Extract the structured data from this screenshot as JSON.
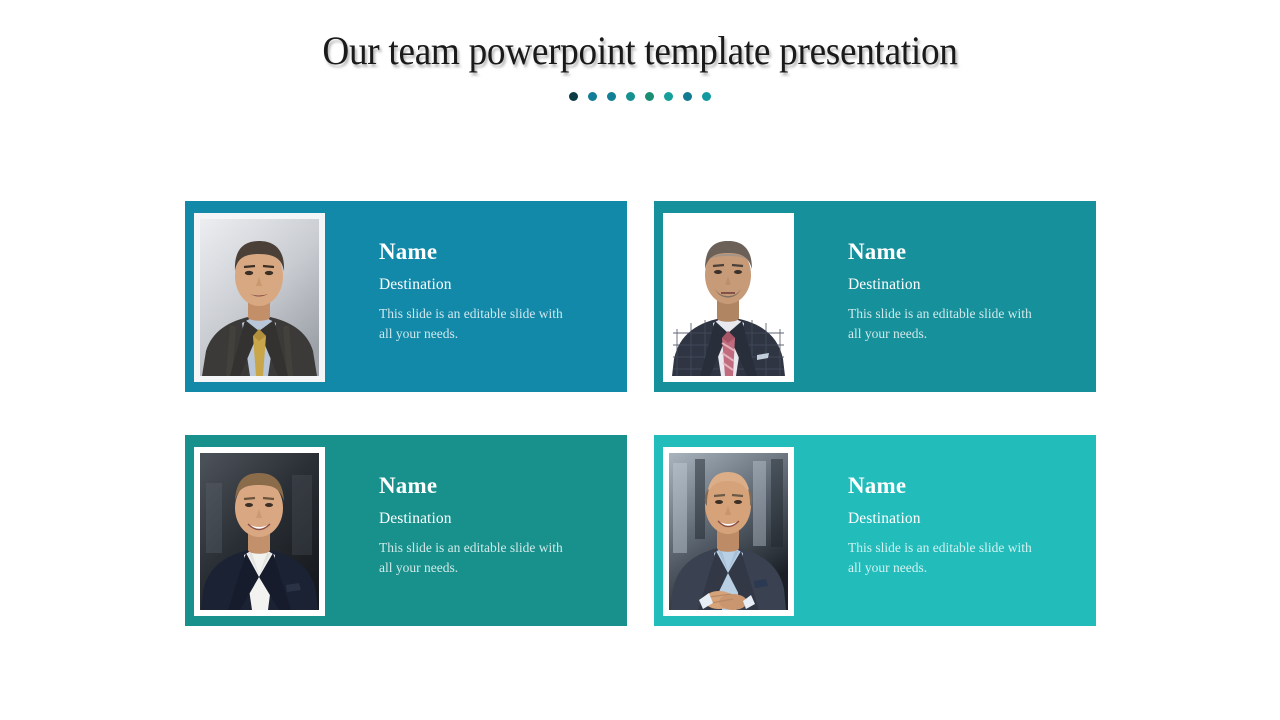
{
  "slide": {
    "background_color": "#ffffff",
    "title": "Our team powerpoint template presentation",
    "title_color": "#1a1a1a"
  },
  "divider_dots": [
    {
      "color": "#0b3c46"
    },
    {
      "color": "#127d96"
    },
    {
      "color": "#117f95"
    },
    {
      "color": "#169190"
    },
    {
      "color": "#198e72"
    },
    {
      "color": "#17a09b"
    },
    {
      "color": "#127b93"
    },
    {
      "color": "#139aa0"
    }
  ],
  "cards": [
    {
      "name": "Name",
      "role": "Destination",
      "description": "This slide is an editable slide with all your needs.",
      "bg_color": "#1289a8",
      "frame_color": "#f4f5f6",
      "photo": {
        "alt": "Portrait of a man in a dark pinstripe suit with a gold patterned tie on a grey studio backdrop",
        "backdrop_from": "#e7e9ec",
        "backdrop_to": "#9ea3aa",
        "suit_color": "#3b3a38",
        "shirt_color": "#b9c6d8",
        "tie_color": "#c9a64a",
        "skin_color": "#d8a882",
        "hair_color": "#4a4038"
      }
    },
    {
      "name": "Name",
      "role": "Destination",
      "description": "This slide is an editable slide with all your needs.",
      "bg_color": "#16909a",
      "frame_color": "#ffffff",
      "photo": {
        "alt": "Portrait of a man in a navy plaid suit with a pink striped tie on a white background",
        "backdrop_from": "#ffffff",
        "backdrop_to": "#f7f7f7",
        "suit_color": "#2f3542",
        "shirt_color": "#e8e8ee",
        "tie_color": "#c06b7e",
        "skin_color": "#c79a78",
        "hair_color": "#6b6159"
      }
    },
    {
      "name": "Name",
      "role": "Destination",
      "description": "This slide is an editable slide with all your needs.",
      "bg_color": "#18918c",
      "frame_color": "#ffffff",
      "photo": {
        "alt": "Portrait of a smiling man with light brown hair in a navy suit and open white shirt on a dark blurred backdrop",
        "backdrop_from": "#3c4146",
        "backdrop_to": "#15181c",
        "suit_color": "#1b2234",
        "shirt_color": "#f2f2f0",
        "tie_color": "#1b2234",
        "skin_color": "#d9a782",
        "hair_color": "#8a6b4a"
      }
    },
    {
      "name": "Name",
      "role": "Destination",
      "description": "This slide is an editable slide with all your needs.",
      "bg_color": "#22bcba",
      "frame_color": "#ffffff",
      "photo": {
        "alt": "Portrait of a bald man in a charcoal suit and light blue shirt with hands clasped, blurred building behind",
        "backdrop_from": "#9aa6b2",
        "backdrop_to": "#1b2026",
        "suit_color": "#3a4150",
        "shirt_color": "#b9cfe4",
        "tie_color": "#3a4150",
        "skin_color": "#d6a279",
        "hair_color": "#7b6a58"
      }
    }
  ]
}
